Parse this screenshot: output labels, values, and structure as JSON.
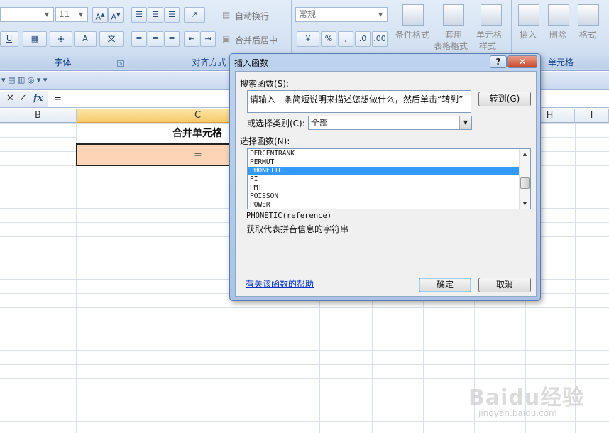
{
  "ribbon": {
    "font_size": "11",
    "number_format": "常规",
    "groups": {
      "font": "字体",
      "alignment": "对齐方式",
      "cells": "单元格"
    },
    "buttons": {
      "wrap_text": "自动换行",
      "merge_center": "合并后居中",
      "conditional_format": "条件格式",
      "format_table_1": "套用",
      "format_table_2": "表格格式",
      "cell_style_1": "单元格",
      "cell_style_2": "样式",
      "insert": "插入",
      "delete": "删除",
      "format": "格式"
    }
  },
  "formula_bar": {
    "cancel": "✕",
    "confirm": "✓",
    "fx": "fx",
    "content": "="
  },
  "sheet": {
    "columns": [
      "B",
      "C",
      "H",
      "I"
    ],
    "merged_title": "合并单元格",
    "active_cell_value": "="
  },
  "dialog": {
    "title": "插入函数",
    "help_button": "?",
    "close_button": "✕",
    "search_label": "搜索函数(S):",
    "search_text": "请输入一条简短说明来描述您想做什么，然后单击“转到”",
    "go_button": "转到(G)",
    "category_label": "或选择类别(C):",
    "category_value": "全部",
    "function_label": "选择函数(N):",
    "functions": [
      "PERCENTRANK",
      "PERMUT",
      "PHONETIC",
      "PI",
      "PMT",
      "POISSON",
      "POWER"
    ],
    "selected_function": "PHONETIC",
    "signature": "PHONETIC(reference)",
    "description": "获取代表拼音信息的字符串",
    "help_link": "有关该函数的帮助",
    "ok_button": "确定",
    "cancel_button": "取消"
  },
  "watermark": {
    "logo": "Baidu经验",
    "url": "jingyan.baidu.com"
  }
}
